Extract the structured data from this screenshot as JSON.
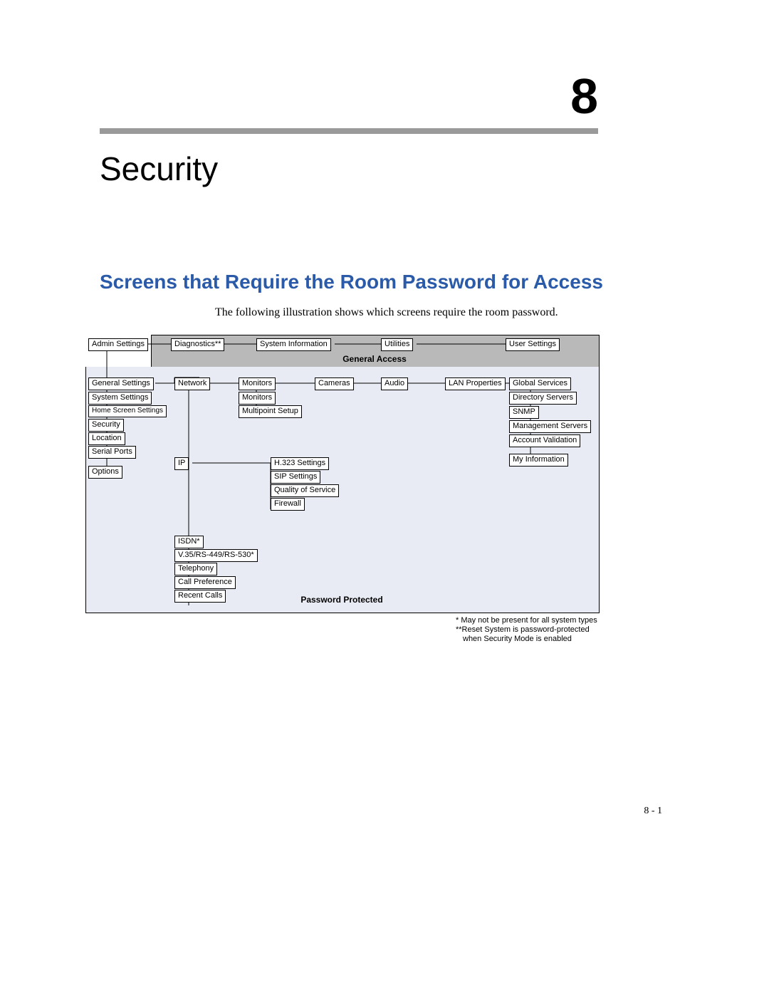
{
  "chapter": {
    "number": "8",
    "title": "Security"
  },
  "section": {
    "title": "Screens that Require the Room Password for Access"
  },
  "intro": "The following illustration shows which screens require the room password.",
  "labels": {
    "general_access": "General Access",
    "password_protected": "Password Protected"
  },
  "top_row": {
    "admin_settings": "Admin Settings",
    "diagnostics": "Diagnostics**",
    "system_information": "System Information",
    "utilities": "Utilities",
    "user_settings": "User Settings"
  },
  "row2": {
    "general_settings": "General Settings",
    "network": "Network",
    "monitors_top": "Monitors",
    "cameras": "Cameras",
    "audio": "Audio",
    "lan_properties": "LAN Properties",
    "global_services": "Global Services"
  },
  "gen_col": {
    "system_settings": "System Settings",
    "home_screen_settings": "Home Screen Settings",
    "security": "Security",
    "location": "Location",
    "serial_ports": "Serial Ports",
    "options": "Options"
  },
  "mon_col": {
    "monitors": "Monitors",
    "multipoint": "Multipoint Setup"
  },
  "ip_label": "IP",
  "ip_col": {
    "h323": "H.323 Settings",
    "sip": "SIP Settings",
    "qos": "Quality of Service",
    "firewall": "Firewall"
  },
  "net_col": {
    "isdn": "ISDN*",
    "v35": "V.35/RS-449/RS-530*",
    "telephony": "Telephony",
    "call_pref": "Call Preference",
    "recent_calls": "Recent Calls"
  },
  "svc_col": {
    "directory": "Directory Servers",
    "snmp": "SNMP",
    "mgmt": "Management Servers",
    "account": "Account Validation",
    "myinfo": "My Information"
  },
  "footnotes": {
    "a": "* May not be present for all system types",
    "b": "**Reset System is password-protected",
    "c": "when Security Mode is enabled"
  },
  "page_number": "8 - 1"
}
